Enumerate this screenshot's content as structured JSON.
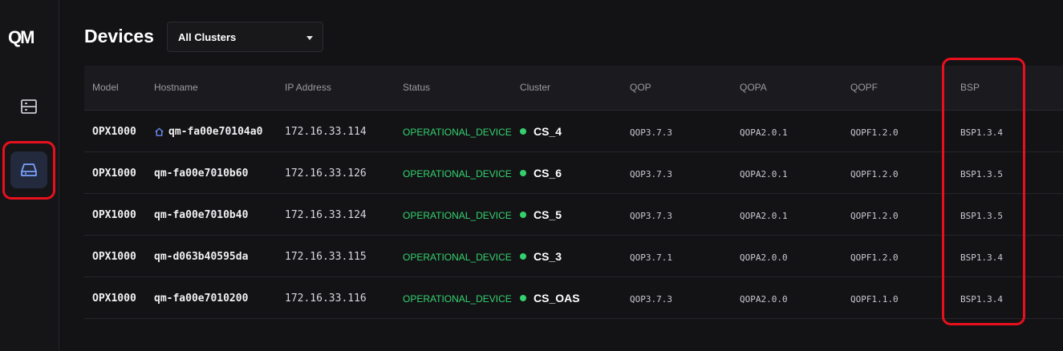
{
  "app": {
    "logo_text": "QM"
  },
  "sidebar": {
    "items": [
      {
        "name": "servers",
        "icon": "server-icon"
      },
      {
        "name": "devices",
        "icon": "hard-drive-icon",
        "active": true
      }
    ]
  },
  "header": {
    "title": "Devices",
    "cluster_filter": {
      "selected": "All Clusters"
    }
  },
  "table": {
    "columns": [
      "Model",
      "Hostname",
      "IP Address",
      "Status",
      "Cluster",
      "QOP",
      "QOPA",
      "QOPF",
      "BSP"
    ],
    "rows": [
      {
        "model": "OPX1000",
        "hostname": "qm-fa00e70104a0",
        "home": true,
        "ip": "172.16.33.114",
        "status": "OPERATIONAL_DEVICE",
        "cluster": "CS_4",
        "qop": "QOP3.7.3",
        "qopa": "QOPA2.0.1",
        "qopf": "QOPF1.2.0",
        "bsp": "BSP1.3.4"
      },
      {
        "model": "OPX1000",
        "hostname": "qm-fa00e7010b60",
        "home": false,
        "ip": "172.16.33.126",
        "status": "OPERATIONAL_DEVICE",
        "cluster": "CS_6",
        "qop": "QOP3.7.3",
        "qopa": "QOPA2.0.1",
        "qopf": "QOPF1.2.0",
        "bsp": "BSP1.3.5"
      },
      {
        "model": "OPX1000",
        "hostname": "qm-fa00e7010b40",
        "home": false,
        "ip": "172.16.33.124",
        "status": "OPERATIONAL_DEVICE",
        "cluster": "CS_5",
        "qop": "QOP3.7.3",
        "qopa": "QOPA2.0.1",
        "qopf": "QOPF1.2.0",
        "bsp": "BSP1.3.5"
      },
      {
        "model": "OPX1000",
        "hostname": "qm-d063b40595da",
        "home": false,
        "ip": "172.16.33.115",
        "status": "OPERATIONAL_DEVICE",
        "cluster": "CS_3",
        "qop": "QOP3.7.1",
        "qopa": "QOPA2.0.0",
        "qopf": "QOPF1.2.0",
        "bsp": "BSP1.3.4"
      },
      {
        "model": "OPX1000",
        "hostname": "qm-fa00e7010200",
        "home": false,
        "ip": "172.16.33.116",
        "status": "OPERATIONAL_DEVICE",
        "cluster": "CS_OAS",
        "qop": "QOP3.7.3",
        "qopa": "QOPA2.0.0",
        "qopf": "QOPF1.1.0",
        "bsp": "BSP1.3.4"
      }
    ]
  },
  "colors": {
    "background": "#131316",
    "status_ok": "#35d26f",
    "highlight": "#e8101c",
    "active_nav": "#232a3d"
  }
}
